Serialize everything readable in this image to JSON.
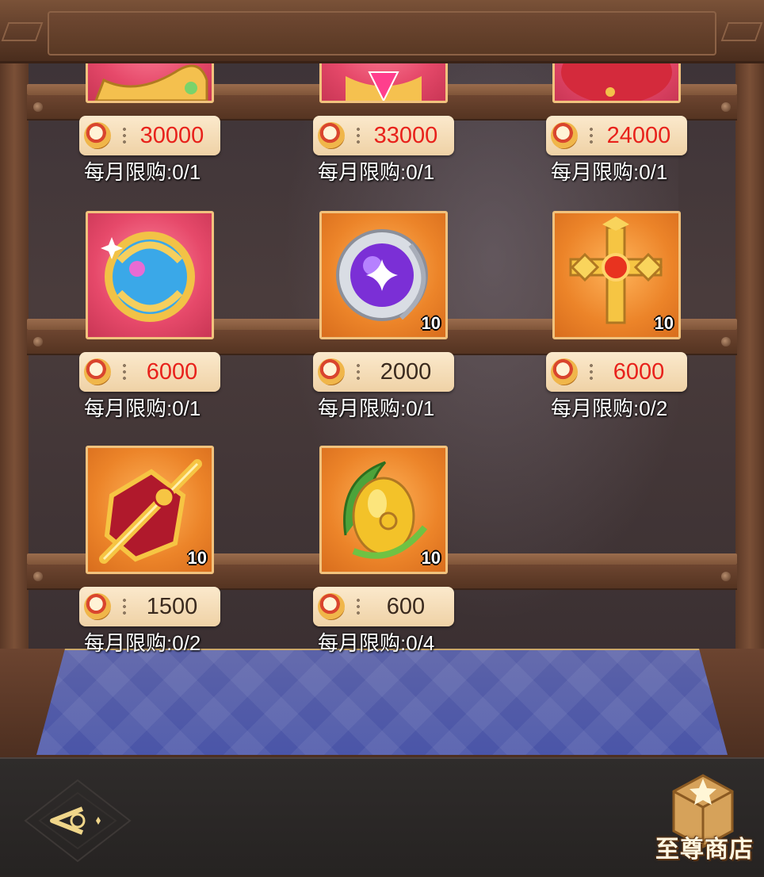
{
  "shop": {
    "title": "至尊商店"
  },
  "nav": {
    "back_icon": "back-arrow-icon"
  },
  "currency_icon": "coin-icon",
  "items": [
    {
      "name": "ornate-horn-relic",
      "price": "30000",
      "price_color": "#e8211b",
      "limit": "每月限购:0/1",
      "quantity": "",
      "frame": "red",
      "icon": "golden-horn-icon"
    },
    {
      "name": "pink-crystal-heart",
      "price": "33000",
      "price_color": "#e8211b",
      "limit": "每月限购:0/1",
      "quantity": "",
      "frame": "red",
      "icon": "pink-gem-icon"
    },
    {
      "name": "red-magic-sigil",
      "price": "24000",
      "price_color": "#e8211b",
      "limit": "每月限购:0/1",
      "quantity": "",
      "frame": "red",
      "icon": "red-sigil-icon"
    },
    {
      "name": "cosmic-orb",
      "price": "6000",
      "price_color": "#e8211b",
      "limit": "每月限购:0/1",
      "quantity": "",
      "frame": "red",
      "icon": "cosmic-orb-icon"
    },
    {
      "name": "purple-moon-orb",
      "price": "2000",
      "price_color": "#3a2a1e",
      "limit": "每月限购:0/1",
      "quantity": "10",
      "frame": "orange",
      "icon": "purple-orb-icon"
    },
    {
      "name": "golden-cross-talisman",
      "price": "6000",
      "price_color": "#e8211b",
      "limit": "每月限购:0/2",
      "quantity": "10",
      "frame": "orange",
      "icon": "golden-cross-icon"
    },
    {
      "name": "crimson-sword-emblem",
      "price": "1500",
      "price_color": "#3a2a1e",
      "limit": "每月限购:0/2",
      "quantity": "10",
      "frame": "orange",
      "icon": "sword-emblem-icon"
    },
    {
      "name": "amber-leaf-egg",
      "price": "600",
      "price_color": "#3a2a1e",
      "limit": "每月限购:0/4",
      "quantity": "10",
      "frame": "orange",
      "icon": "amber-egg-icon"
    }
  ]
}
